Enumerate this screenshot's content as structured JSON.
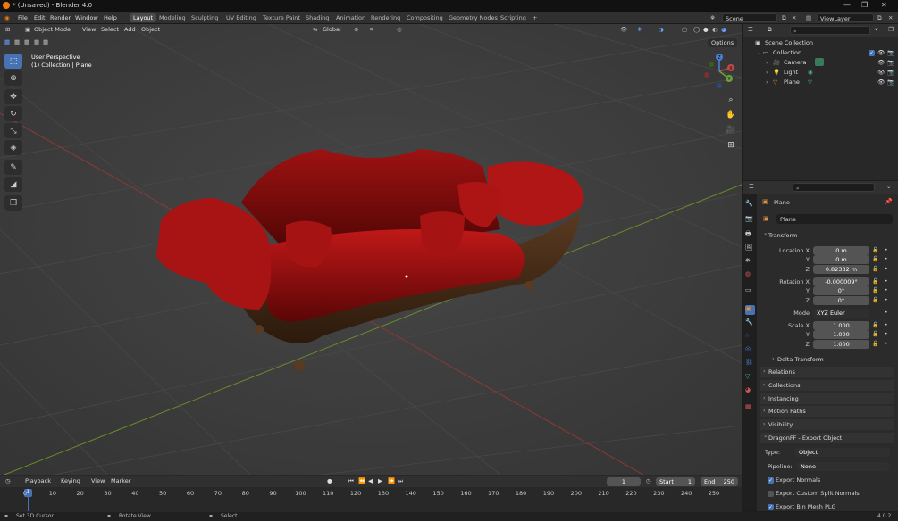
{
  "window": {
    "title": "* (Unsaved) - Blender 4.0",
    "buttons": [
      "—",
      "❐",
      "✕"
    ]
  },
  "menu": [
    "File",
    "Edit",
    "Render",
    "Window",
    "Help"
  ],
  "workspaces": [
    "Layout",
    "Modeling",
    "Sculpting",
    "UV Editing",
    "Texture Paint",
    "Shading",
    "Animation",
    "Rendering",
    "Compositing",
    "Geometry Nodes",
    "Scripting"
  ],
  "active_workspace": "Layout",
  "add_workspace": "+",
  "scene": "Scene",
  "view_layer": "ViewLayer",
  "viewport": {
    "mode": "Object Mode",
    "menus": [
      "View",
      "Select",
      "Add",
      "Object"
    ],
    "orientation": "Global",
    "options_label": "Options",
    "overlay_title": "User Perspective",
    "overlay_sub": "(1) Collection | Plane",
    "gizmo": {
      "x": "X",
      "y": "Y",
      "z": "Z"
    }
  },
  "outliner": {
    "rows": [
      {
        "label": "Scene Collection",
        "indent": 0,
        "icon": "scene-collection-icon"
      },
      {
        "label": "Collection",
        "indent": 1,
        "icon": "collection-icon"
      },
      {
        "label": "Camera",
        "indent": 2,
        "icon": "camera-icon"
      },
      {
        "label": "Light",
        "indent": 2,
        "icon": "light-icon"
      },
      {
        "label": "Plane",
        "indent": 2,
        "icon": "mesh-icon"
      }
    ]
  },
  "properties": {
    "object_name": "Plane",
    "data_name": "Plane",
    "transform_label": "Transform",
    "location": {
      "label": "Location X",
      "x": "0 m",
      "y": "0 m",
      "z": "0.82332 m"
    },
    "rotation": {
      "label": "Rotation X",
      "x": "-0.000009°",
      "y": "0°",
      "z": "0°"
    },
    "mode": {
      "label": "Mode",
      "value": "XYZ Euler"
    },
    "scale": {
      "label": "Scale X",
      "x": "1.000",
      "y": "1.000",
      "z": "1.000"
    },
    "axis_y": "Y",
    "axis_z": "Z",
    "panels": [
      "Delta Transform",
      "Relations",
      "Collections",
      "Instancing",
      "Motion Paths",
      "Visibility"
    ],
    "addon_panel": "DragonFF - Export Object",
    "type_label": "Type:",
    "type_value": "Object",
    "pipeline_label": "Pipeline:",
    "pipeline_value": "None",
    "checks": [
      {
        "label": "Export Normals",
        "checked": true
      },
      {
        "label": "Export Custom Split Normals",
        "checked": false
      },
      {
        "label": "Export Bin Mesh PLG",
        "checked": true
      }
    ]
  },
  "timeline": {
    "menus": [
      "Playback",
      "Keying",
      "View",
      "Marker"
    ],
    "current_frame": "1",
    "start_label": "Start",
    "start": "1",
    "end_label": "End",
    "end": "250",
    "ticks": [
      "0",
      "10",
      "20",
      "30",
      "40",
      "50",
      "60",
      "70",
      "80",
      "90",
      "100",
      "110",
      "120",
      "130",
      "140",
      "150",
      "160",
      "170",
      "180",
      "190",
      "200",
      "210",
      "220",
      "230",
      "240",
      "250"
    ],
    "playhead": "1"
  },
  "status": {
    "left": "Set 3D Cursor",
    "mid": "Rotate View",
    "right": "Select",
    "version": "4.0.2"
  }
}
